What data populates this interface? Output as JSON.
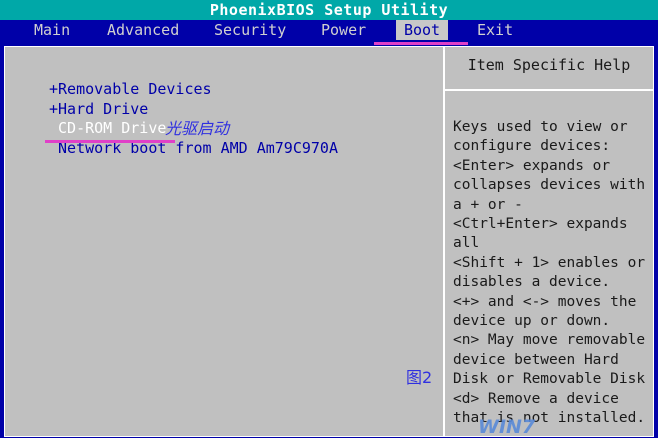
{
  "window": {
    "title": "PhoenixBIOS Setup Utility"
  },
  "menu": {
    "items": [
      {
        "label": "Main"
      },
      {
        "label": "Advanced"
      },
      {
        "label": "Security"
      },
      {
        "label": "Power"
      },
      {
        "label": "Boot",
        "active": true
      },
      {
        "label": "Exit"
      }
    ]
  },
  "boot_order": {
    "items": [
      {
        "label": "+Removable Devices"
      },
      {
        "label": "+Hard Drive"
      },
      {
        "label": " CD-ROM Drive",
        "selected": true
      },
      {
        "label": " Network boot from AMD Am79C970A"
      }
    ],
    "annotation": "光驱启动"
  },
  "help": {
    "title": "Item Specific Help",
    "lines": [
      "Keys used to view or",
      "configure devices:",
      "<Enter> expands or",
      "collapses devices with",
      "a + or -",
      "<Ctrl+Enter> expands",
      "all",
      "<Shift + 1> enables or",
      "disables a device.",
      "<+> and <-> moves the",
      "device up or down.",
      "<n> May move removable",
      "device between Hard",
      "Disk or Removable Disk",
      "<d> Remove a device",
      "that is not installed."
    ]
  },
  "figure_label": "图2",
  "watermark": "WIN7",
  "colors": {
    "background": "#0000a8",
    "title_bar": "#00a8a8",
    "panel": "#c0c0c0",
    "highlight": "#e040c8"
  }
}
